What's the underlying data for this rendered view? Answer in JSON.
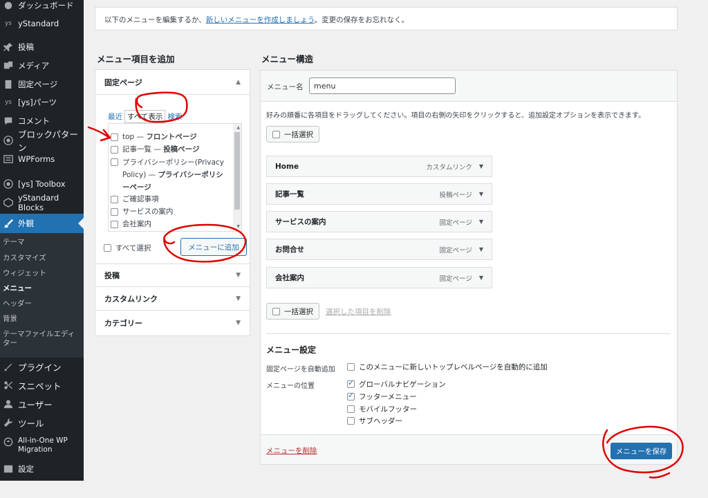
{
  "sidebar": {
    "items": [
      {
        "label": "ダッシュボード",
        "icon": "dashboard-icon"
      },
      {
        "label": "yStandard",
        "icon": "ystandard-icon"
      },
      {
        "label": "投稿",
        "icon": "pin-icon"
      },
      {
        "label": "メディア",
        "icon": "media-icon"
      },
      {
        "label": "固定ページ",
        "icon": "page-icon"
      },
      {
        "label": "[ys]パーツ",
        "icon": "ys-icon"
      },
      {
        "label": "コメント",
        "icon": "comment-icon"
      },
      {
        "label": "ブロックパターン",
        "icon": "pattern-icon"
      },
      {
        "label": "WPForms",
        "icon": "forms-icon"
      },
      {
        "label": "[ys] Toolbox",
        "icon": "toolbox-icon"
      },
      {
        "label": "yStandard Blocks",
        "icon": "blocks-icon"
      },
      {
        "label": "外観",
        "icon": "brush-icon"
      },
      {
        "label": "プラグイン",
        "icon": "plugin-icon"
      },
      {
        "label": "スニペット",
        "icon": "snippet-icon"
      },
      {
        "label": "ユーザー",
        "icon": "user-icon"
      },
      {
        "label": "ツール",
        "icon": "wrench-icon"
      },
      {
        "label": "All-in-One WP Migration",
        "icon": "migration-icon"
      },
      {
        "label": "設定",
        "icon": "settings-icon"
      }
    ],
    "submenu": [
      "テーマ",
      "カスタマイズ",
      "ウィジェット",
      "メニュー",
      "ヘッダー",
      "背景",
      "テーマファイルエディター"
    ]
  },
  "notice": {
    "before": "以下のメニューを編集するか、",
    "link": "新しいメニューを作成しましょう",
    "after": "。変更の保存をお忘れなく。"
  },
  "add_items": {
    "heading": "メニュー項目を追加",
    "sections": [
      "固定ページ",
      "投稿",
      "カスタムリンク",
      "カテゴリー"
    ],
    "tabs": [
      "最近",
      "すべて表示",
      "検索"
    ],
    "pages": [
      {
        "prefix": "top — ",
        "bold": "フロントページ"
      },
      {
        "prefix": "記事一覧 — ",
        "bold": "投稿ページ"
      },
      {
        "prefix": "プライバシーポリシー(Privacy Policy) — ",
        "bold": "プライバシーポリシーページ"
      },
      {
        "prefix": "ご確認事項",
        "bold": ""
      },
      {
        "prefix": "サービスの案内",
        "bold": ""
      },
      {
        "prefix": "会社案内",
        "bold": ""
      }
    ],
    "select_all": "すべて選択",
    "add_button": "メニューに追加"
  },
  "structure": {
    "heading": "メニュー構造",
    "name_label": "メニュー名",
    "name_value": "menu",
    "instructions": "好みの順番に各項目をドラッグしてください。項目の右側の矢印をクリックすると、追加設定オプションを表示できます。",
    "bulk_select": "一括選択",
    "remove_selected": "選択した項目を削除",
    "items": [
      {
        "title": "Home",
        "type": "カスタムリンク"
      },
      {
        "title": "記事一覧",
        "type": "投稿ページ"
      },
      {
        "title": "サービスの案内",
        "type": "固定ページ"
      },
      {
        "title": "お問合せ",
        "type": "固定ページ"
      },
      {
        "title": "会社案内",
        "type": "固定ページ"
      }
    ],
    "settings": {
      "heading": "メニュー設定",
      "auto_add_label": "固定ページを自動追加",
      "auto_add_option": "このメニューに新しいトップレベルページを自動的に追加",
      "locations_label": "メニューの位置",
      "locations": [
        {
          "label": "グローバルナビゲーション",
          "checked": true
        },
        {
          "label": "フッターメニュー",
          "checked": true
        },
        {
          "label": "モバイルフッター",
          "checked": false
        },
        {
          "label": "サブヘッダー",
          "checked": false
        }
      ]
    },
    "delete_menu": "メニューを削除",
    "save_button": "メニューを保存"
  },
  "colors": {
    "admin_bar": "#1d2327",
    "accent": "#2271b1",
    "annotation": "#e00000"
  }
}
